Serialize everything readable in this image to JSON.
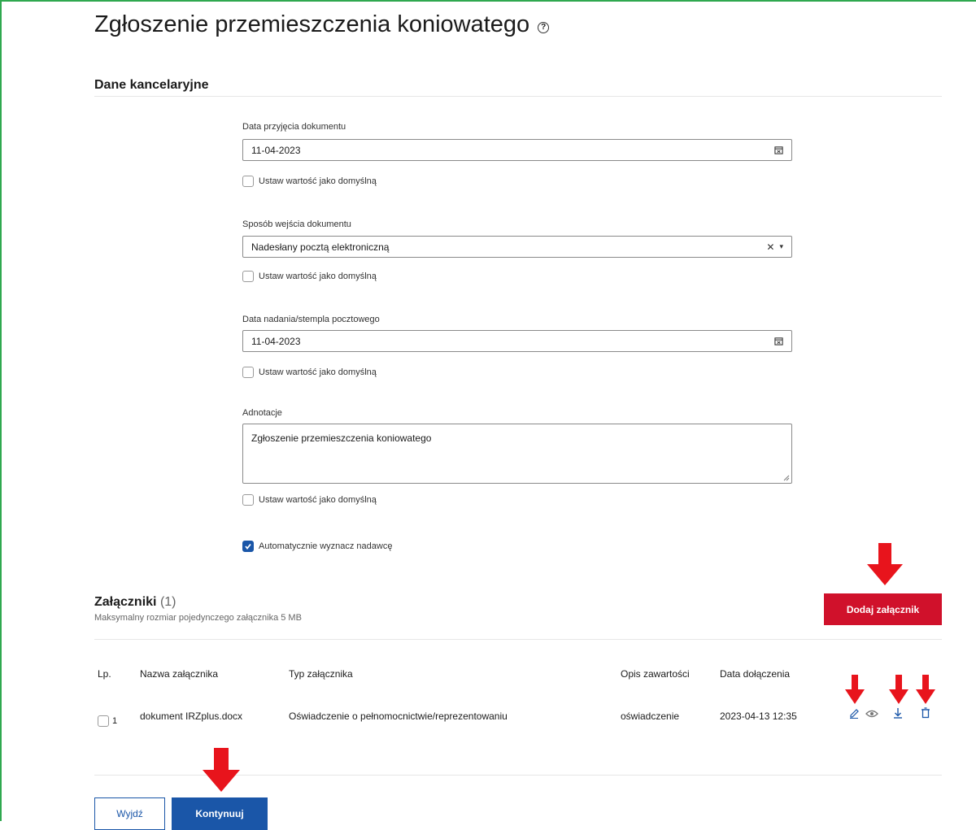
{
  "page": {
    "title": "Zgłoszenie przemieszczenia koniowatego"
  },
  "section": {
    "title": "Dane kancelaryjne"
  },
  "fields": {
    "date_received": {
      "label": "Data przyjęcia dokumentu",
      "value": "11-04-2023",
      "default_label": "Ustaw wartość jako domyślną"
    },
    "entry_method": {
      "label": "Sposób wejścia dokumentu",
      "value": "Nadesłany pocztą elektroniczną",
      "default_label": "Ustaw wartość jako domyślną"
    },
    "postmark_date": {
      "label": "Data nadania/stempla pocztowego",
      "value": "11-04-2023",
      "default_label": "Ustaw wartość jako domyślną"
    },
    "annotations": {
      "label": "Adnotacje",
      "value": "Zgłoszenie przemieszczenia koniowatego",
      "default_label": "Ustaw wartość jako domyślną"
    },
    "auto_sender": {
      "label": "Automatycznie wyznacz nadawcę",
      "checked": true
    }
  },
  "attachments": {
    "title": "Załączniki",
    "count": "(1)",
    "subtitle": "Maksymalny rozmiar pojedynczego załącznika 5 MB",
    "add_button": "Dodaj załącznik",
    "columns": [
      "Lp.",
      "Nazwa załącznika",
      "Typ załącznika",
      "Opis zawartości",
      "Data dołączenia"
    ],
    "rows": [
      {
        "lp": "1",
        "name": "dokument IRZplus.docx",
        "type": "Oświadczenie o pełnomocnictwie/reprezentowaniu",
        "description": "oświadczenie",
        "date": "2023-04-13 12:35"
      }
    ]
  },
  "footer": {
    "exit_button": "Wyjdź",
    "continue_button": "Kontynuuj"
  },
  "colors": {
    "primary": "#1a56a8",
    "danger": "#d0112b",
    "arrow": "#e8141c",
    "frame": "#2fa84f"
  }
}
